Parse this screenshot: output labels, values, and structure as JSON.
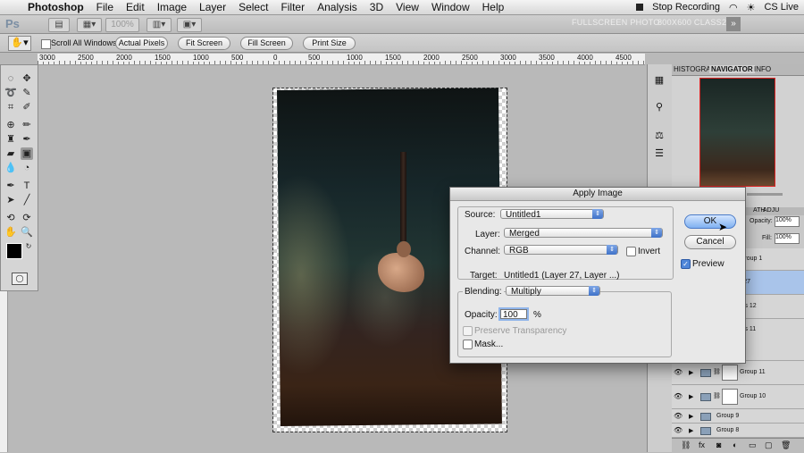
{
  "menubar": {
    "apple_icon": "apple-icon",
    "app": "Photoshop",
    "menus": [
      "File",
      "Edit",
      "Image",
      "Layer",
      "Select",
      "Filter",
      "Analysis",
      "3D",
      "View",
      "Window",
      "Help"
    ],
    "status": "Stop Recording",
    "right_label": "CS Live"
  },
  "appbar": {
    "logo": "Ps",
    "zoom": "100%",
    "workspaces": [
      "FULLSCREEN PHOTO",
      "800X600 CLASS2"
    ],
    "more": "»"
  },
  "optionsbar": {
    "scroll_all_windows": "Scroll All Windows",
    "actual_pixels": "Actual Pixels",
    "fit_screen": "Fit Screen",
    "fill_screen": "Fill Screen",
    "print_size": "Print Size"
  },
  "ruler": {
    "ticks": [
      "3000",
      "2500",
      "2000",
      "1500",
      "1000",
      "500",
      "0",
      "500",
      "1000",
      "1500",
      "2000",
      "2500",
      "3000",
      "3500",
      "4000",
      "4500"
    ]
  },
  "panels": {
    "top_tabs": [
      "HISTOGRA",
      "NAVIGATOR",
      "INFO"
    ],
    "opacity_label": "Opacity:",
    "opacity_value": "100%",
    "fill_label": "Fill:",
    "fill_value": "100%",
    "path_tab": "ATH",
    "adju_tab": "ADJU",
    "layers": [
      {
        "name": "Group 1",
        "selected": false
      },
      {
        "name": "r 27",
        "selected": true
      },
      {
        "name": "els 12",
        "selected": false
      },
      {
        "name": "els 11",
        "selected": false
      },
      {
        "name": "Group 11",
        "selected": false
      },
      {
        "name": "Group 10",
        "selected": false
      },
      {
        "name": "Group 9",
        "selected": false
      },
      {
        "name": "Group 8",
        "selected": false
      }
    ]
  },
  "dialog": {
    "title": "Apply Image",
    "source_label": "Source:",
    "source_value": "Untitled1",
    "layer_label": "Layer:",
    "layer_value": "Merged",
    "channel_label": "Channel:",
    "channel_value": "RGB",
    "invert_label": "Invert",
    "target_label": "Target:",
    "target_value": "Untitled1 (Layer 27, Layer ...)",
    "blending_label": "Blending:",
    "blending_value": "Multiply",
    "opacity_label": "Opacity:",
    "opacity_value": "100",
    "opacity_unit": "%",
    "preserve_label": "Preserve Transparency",
    "mask_label": "Mask...",
    "ok_label": "OK",
    "cancel_label": "Cancel",
    "preview_label": "Preview",
    "preview_checked": true,
    "invert_checked": false
  }
}
